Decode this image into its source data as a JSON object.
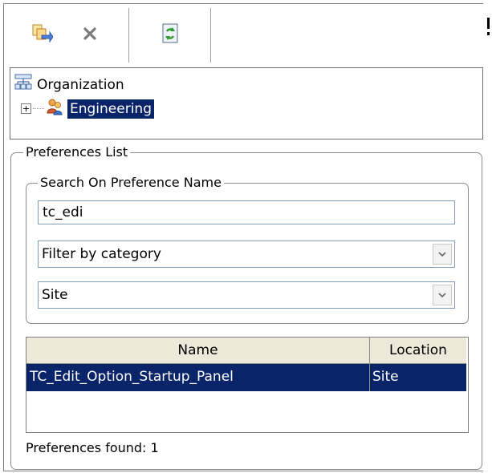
{
  "toolbar": {
    "icons": [
      "add-preference-icon",
      "delete-icon",
      "refresh-icon"
    ]
  },
  "tree": {
    "root_label": "Organization",
    "child_label": "Engineering",
    "expander_symbol": "+"
  },
  "preferences_list": {
    "title": "Preferences List",
    "search_group_title": "Search On Preference Name",
    "search_value": "tc_edi",
    "category_selected": "Filter by category",
    "scope_selected": "Site",
    "table": {
      "columns": [
        "Name",
        "Location"
      ],
      "rows": [
        {
          "name": "TC_Edit_Option_Startup_Panel",
          "location": "Site"
        }
      ]
    },
    "status_text": "Preferences found: 1"
  },
  "colors": {
    "selection": "#0a246a",
    "header_bg": "#ece9d8",
    "border": "#7f9db9"
  }
}
